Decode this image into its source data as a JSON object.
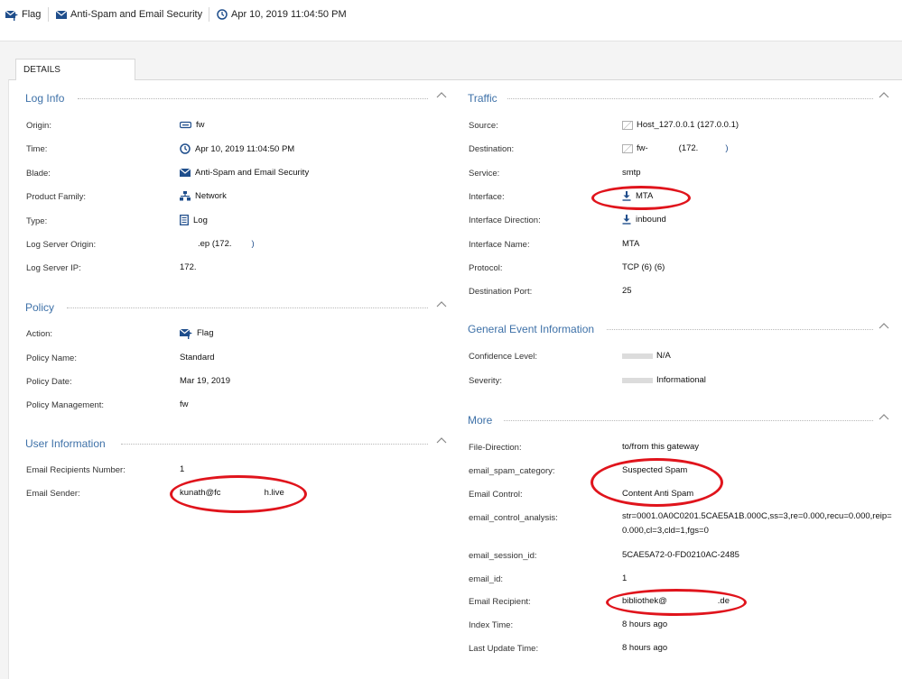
{
  "header": {
    "action": "Flag",
    "blade": "Anti-Spam and Email Security",
    "time": "Apr 10, 2019 11:04:50 PM"
  },
  "tabs": {
    "details": "DETAILS"
  },
  "log_info": {
    "title": "Log Info",
    "rows": [
      {
        "label": "Origin:",
        "value": "fw",
        "icon": "gateway-icon"
      },
      {
        "label": "Time:",
        "value": "Apr 10, 2019 11:04:50 PM",
        "icon": "clock-icon"
      },
      {
        "label": "Blade:",
        "value": "Anti-Spam and Email Security",
        "icon": "envelope-icon"
      },
      {
        "label": "Product Family:",
        "value": "Network",
        "icon": "network-icon"
      },
      {
        "label": "Type:",
        "value": "Log",
        "icon": "log-icon"
      },
      {
        "label": "Log Server Origin:",
        "value": ".ep (172.",
        "value_end": ")"
      },
      {
        "label": "Log Server IP:",
        "value": "172."
      }
    ]
  },
  "policy": {
    "title": "Policy",
    "rows": [
      {
        "label": "Action:",
        "value": "Flag",
        "icon": "flag-icon"
      },
      {
        "label": "Policy Name:",
        "value": "Standard"
      },
      {
        "label": "Policy Date:",
        "value": "Mar 19, 2019"
      },
      {
        "label": "Policy Management:",
        "value": "fw"
      }
    ]
  },
  "user_information": {
    "title": "User Information",
    "rows": [
      {
        "label": "Email Recipients Number:",
        "value": "1"
      },
      {
        "label": "Email Sender:",
        "value": "kunath@fc",
        "value_end": "h.live"
      }
    ]
  },
  "traffic": {
    "title": "Traffic",
    "rows": [
      {
        "label": "Source:",
        "value": "Host_127.0.0.1 (127.0.0.1)",
        "icon": "host-icon"
      },
      {
        "label": "Destination:",
        "value": "fw-",
        "value_mid": "(172.",
        "value_end": ")",
        "icon": "host-icon"
      },
      {
        "label": "Service:",
        "value": "smtp"
      },
      {
        "label": "Interface:",
        "value": "MTA",
        "icon": "download-icon"
      },
      {
        "label": "Interface Direction:",
        "value": "inbound",
        "icon": "download-icon"
      },
      {
        "label": "Interface Name:",
        "value": "MTA"
      },
      {
        "label": "Protocol:",
        "value": "TCP (6) (6)"
      },
      {
        "label": "Destination Port:",
        "value": "25"
      }
    ]
  },
  "general_event": {
    "title": "General Event Information",
    "rows": [
      {
        "label": "Confidence Level:",
        "value": "N/A"
      },
      {
        "label": "Severity:",
        "value": "Informational"
      }
    ]
  },
  "more": {
    "title": "More",
    "rows": [
      {
        "label": "File-Direction:",
        "value": "to/from this gateway"
      },
      {
        "label": "email_spam_category:",
        "value": "Suspected Spam"
      },
      {
        "label": "Email Control:",
        "value": "Content Anti Spam"
      },
      {
        "label": "email_control_analysis:",
        "value": "str=0001.0A0C0201.5CAE5A1B.000C,ss=3,re=0.000,recu=0.000,reip=0.000,cl=3,cld=1,fgs=0"
      },
      {
        "label": "email_session_id:",
        "value": "5CAE5A72-0-FD0210AC-2485"
      },
      {
        "label": "email_id:",
        "value": "1"
      },
      {
        "label": "Email Recipient:",
        "value": "bibliothek@",
        "value_end": ".de"
      },
      {
        "label": "Index Time:",
        "value": "8 hours ago"
      },
      {
        "label": "Last Update Time:",
        "value": "8 hours ago"
      }
    ]
  },
  "colors": {
    "section_title": "#3e71a8",
    "icon_blue": "#1f4e8c",
    "highlight_red": "#e0141c"
  }
}
